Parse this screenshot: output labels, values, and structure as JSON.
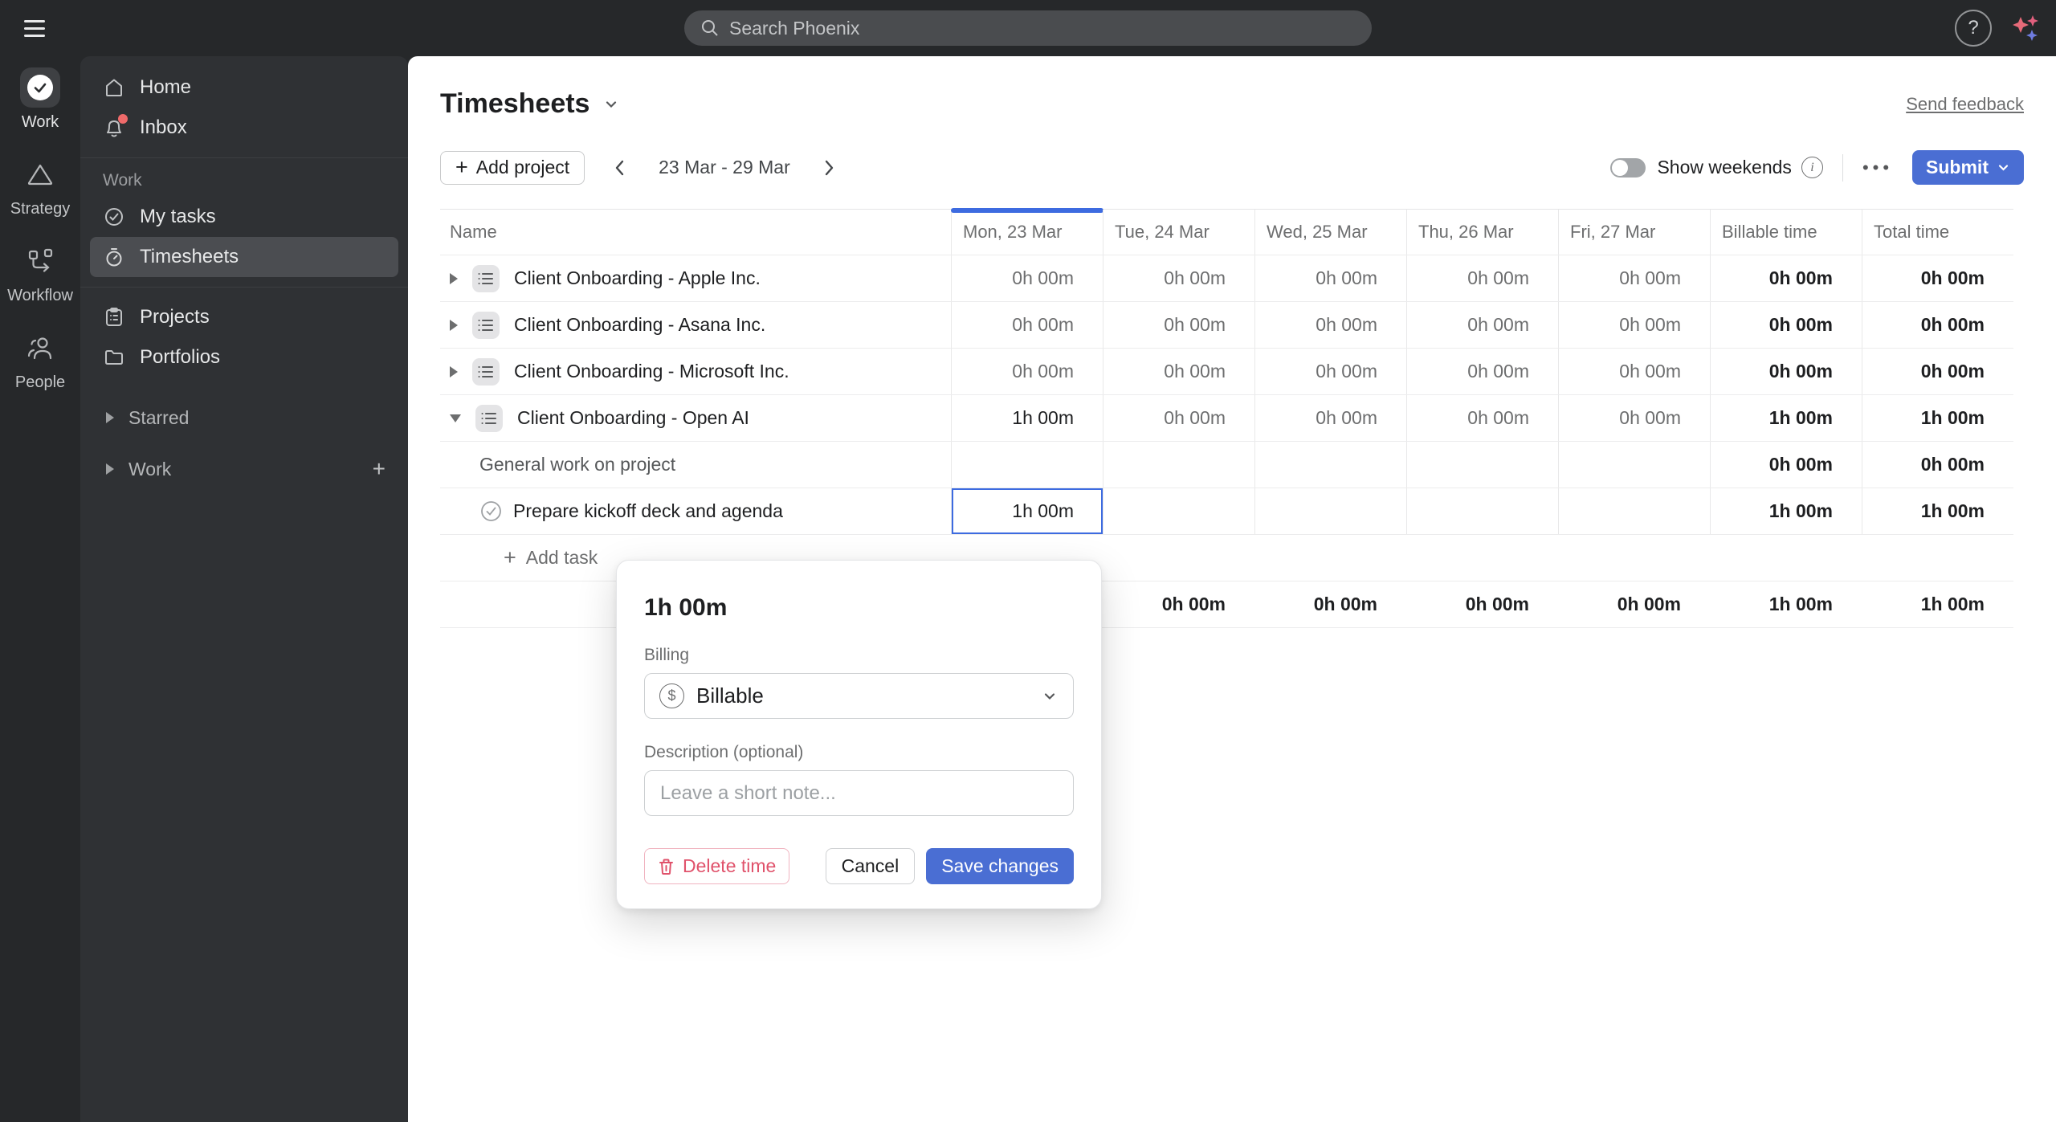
{
  "topbar": {
    "search_placeholder": "Search Phoenix",
    "help_label": "?"
  },
  "rail": {
    "items": [
      {
        "label": "Work",
        "selected": true
      },
      {
        "label": "Strategy",
        "selected": false
      },
      {
        "label": "Workflow",
        "selected": false
      },
      {
        "label": "People",
        "selected": false
      }
    ]
  },
  "sidebar": {
    "home": "Home",
    "inbox": "Inbox",
    "inbox_has_unread": true,
    "section": "Work",
    "my_tasks": "My tasks",
    "timesheets": "Timesheets",
    "selected_item": "Timesheets",
    "projects": "Projects",
    "portfolios": "Portfolios",
    "starred": "Starred",
    "work_group": "Work"
  },
  "header": {
    "title": "Timesheets",
    "feedback": "Send feedback"
  },
  "toolbar": {
    "add_project": "Add project",
    "date_range": "23 Mar - 29 Mar",
    "show_weekends": "Show weekends",
    "show_weekends_enabled": false,
    "submit": "Submit"
  },
  "table": {
    "columns": [
      "Name",
      "Mon, 23 Mar",
      "Tue, 24 Mar",
      "Wed, 25 Mar",
      "Thu, 26 Mar",
      "Fri, 27 Mar",
      "Billable time",
      "Total time"
    ],
    "selected_column_index": 1,
    "rows": [
      {
        "kind": "project",
        "name": "Client Onboarding - Apple Inc.",
        "expanded": false,
        "days": [
          "0h 00m",
          "0h 00m",
          "0h 00m",
          "0h 00m",
          "0h 00m"
        ],
        "billable": "0h 00m",
        "total": "0h 00m"
      },
      {
        "kind": "project",
        "name": "Client Onboarding - Asana Inc.",
        "expanded": false,
        "days": [
          "0h 00m",
          "0h 00m",
          "0h 00m",
          "0h 00m",
          "0h 00m"
        ],
        "billable": "0h 00m",
        "total": "0h 00m"
      },
      {
        "kind": "project",
        "name": "Client Onboarding - Microsoft Inc.",
        "expanded": false,
        "days": [
          "0h 00m",
          "0h 00m",
          "0h 00m",
          "0h 00m",
          "0h 00m"
        ],
        "billable": "0h 00m",
        "total": "0h 00m"
      },
      {
        "kind": "project",
        "name": "Client Onboarding - Open AI",
        "expanded": true,
        "days": [
          "1h 00m",
          "0h 00m",
          "0h 00m",
          "0h 00m",
          "0h 00m"
        ],
        "billable": "1h 00m",
        "total": "1h 00m"
      },
      {
        "kind": "general",
        "name": "General work on project",
        "days": [
          "",
          "",
          "",
          "",
          ""
        ],
        "billable": "0h 00m",
        "total": "0h 00m"
      },
      {
        "kind": "task",
        "name": "Prepare kickoff deck and agenda",
        "selected_day": 0,
        "days": [
          "1h 00m",
          "",
          "",
          "",
          ""
        ],
        "billable": "1h 00m",
        "total": "1h 00m"
      }
    ],
    "add_task": "Add task",
    "totals": {
      "days": [
        "",
        "0h 00m",
        "0h 00m",
        "0h 00m",
        "0h 00m"
      ],
      "billable": "1h 00m",
      "total": "1h 00m"
    }
  },
  "popup": {
    "duration": "1h 00m",
    "billing_label": "Billing",
    "billing_value": "Billable",
    "description_label": "Description (optional)",
    "description_placeholder": "Leave a short note...",
    "delete_label": "Delete time",
    "cancel_label": "Cancel",
    "save_label": "Save changes"
  },
  "colors": {
    "accent": "#4a6ed3",
    "accent_bright": "#3d6be0",
    "danger": "#e0526b",
    "chrome": "#26282a",
    "sidebar": "#2f3134",
    "unread_badge": "#ef6a6a"
  }
}
